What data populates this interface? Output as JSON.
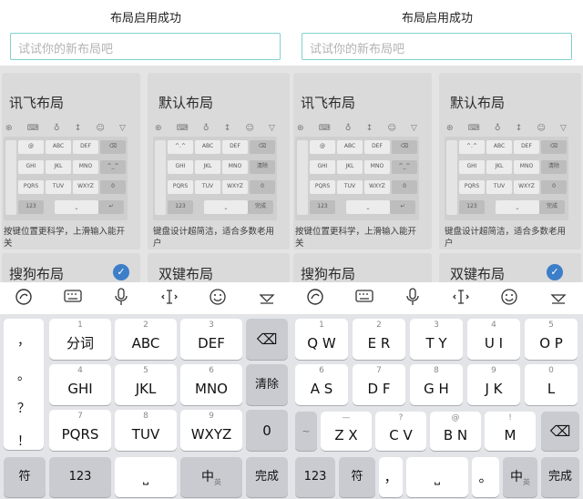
{
  "title": "布局启用成功",
  "placeholder": "试试你的新布局吧",
  "cards": {
    "xunfei": {
      "name": "讯飞布局",
      "desc": "按键位置更科学，上滑输入能开关"
    },
    "default": {
      "name": "默认布局",
      "desc": "键盘设计超简洁，适合多数老用户"
    },
    "sogou": {
      "name": "搜狗布局"
    },
    "dual": {
      "name": "双键布局"
    }
  },
  "mini_icons": [
    "⊛",
    "⌨",
    "♁",
    "↕",
    "☺",
    "▽"
  ],
  "mini_xunfei": [
    "@",
    "ABC",
    "DEF",
    "⌫",
    "GHI",
    "JKL",
    "MNO",
    "^_^",
    "PQRS",
    "TUV",
    "WXYZ",
    "0",
    "123",
    "⎵",
    "↵"
  ],
  "mini_default": [
    "^.^",
    "ABC",
    "DEF",
    "⌫",
    "GHI",
    "JKL",
    "MNO",
    "清除",
    "PQRS",
    "TUV",
    "WXYZ",
    "0",
    "123",
    "⎵",
    "完成"
  ],
  "left": {
    "side": [
      "，",
      "。",
      "？",
      "！"
    ],
    "keys": [
      {
        "n": "1",
        "l": "分词"
      },
      {
        "n": "2",
        "l": "ABC"
      },
      {
        "n": "3",
        "l": "DEF"
      },
      {
        "n": "4",
        "l": "GHI"
      },
      {
        "n": "5",
        "l": "JKL"
      },
      {
        "n": "6",
        "l": "MNO"
      },
      {
        "n": "7",
        "l": "PQRS"
      },
      {
        "n": "8",
        "l": "TUV"
      },
      {
        "n": "9",
        "l": "WXYZ"
      }
    ],
    "clear": "清除",
    "zero": "0",
    "fu": "符",
    "num": "123",
    "zh": "中",
    "zh_sub": "英",
    "done": "完成"
  },
  "right": {
    "row1": [
      {
        "n": "1",
        "l": "Q W"
      },
      {
        "n": "2",
        "l": "E R"
      },
      {
        "n": "3",
        "l": "T Y"
      },
      {
        "n": "4",
        "l": "U I"
      },
      {
        "n": "5",
        "l": "O P"
      }
    ],
    "row2": [
      {
        "n": "6",
        "l": "A S"
      },
      {
        "n": "7",
        "l": "D F"
      },
      {
        "n": "8",
        "l": "G H"
      },
      {
        "n": "9",
        "l": "J K"
      },
      {
        "n": "0",
        "l": "L"
      }
    ],
    "row3": [
      {
        "n": "—",
        "l": "Z X"
      },
      {
        "n": "?",
        "l": "C V"
      },
      {
        "n": "@",
        "l": "B N"
      },
      {
        "n": "!",
        "l": "M"
      }
    ],
    "row3_left": "~",
    "num": "123",
    "fu": "符",
    "comma": "，",
    "period": "。",
    "zh": "中",
    "zh_sub": "英",
    "done": "完成"
  }
}
